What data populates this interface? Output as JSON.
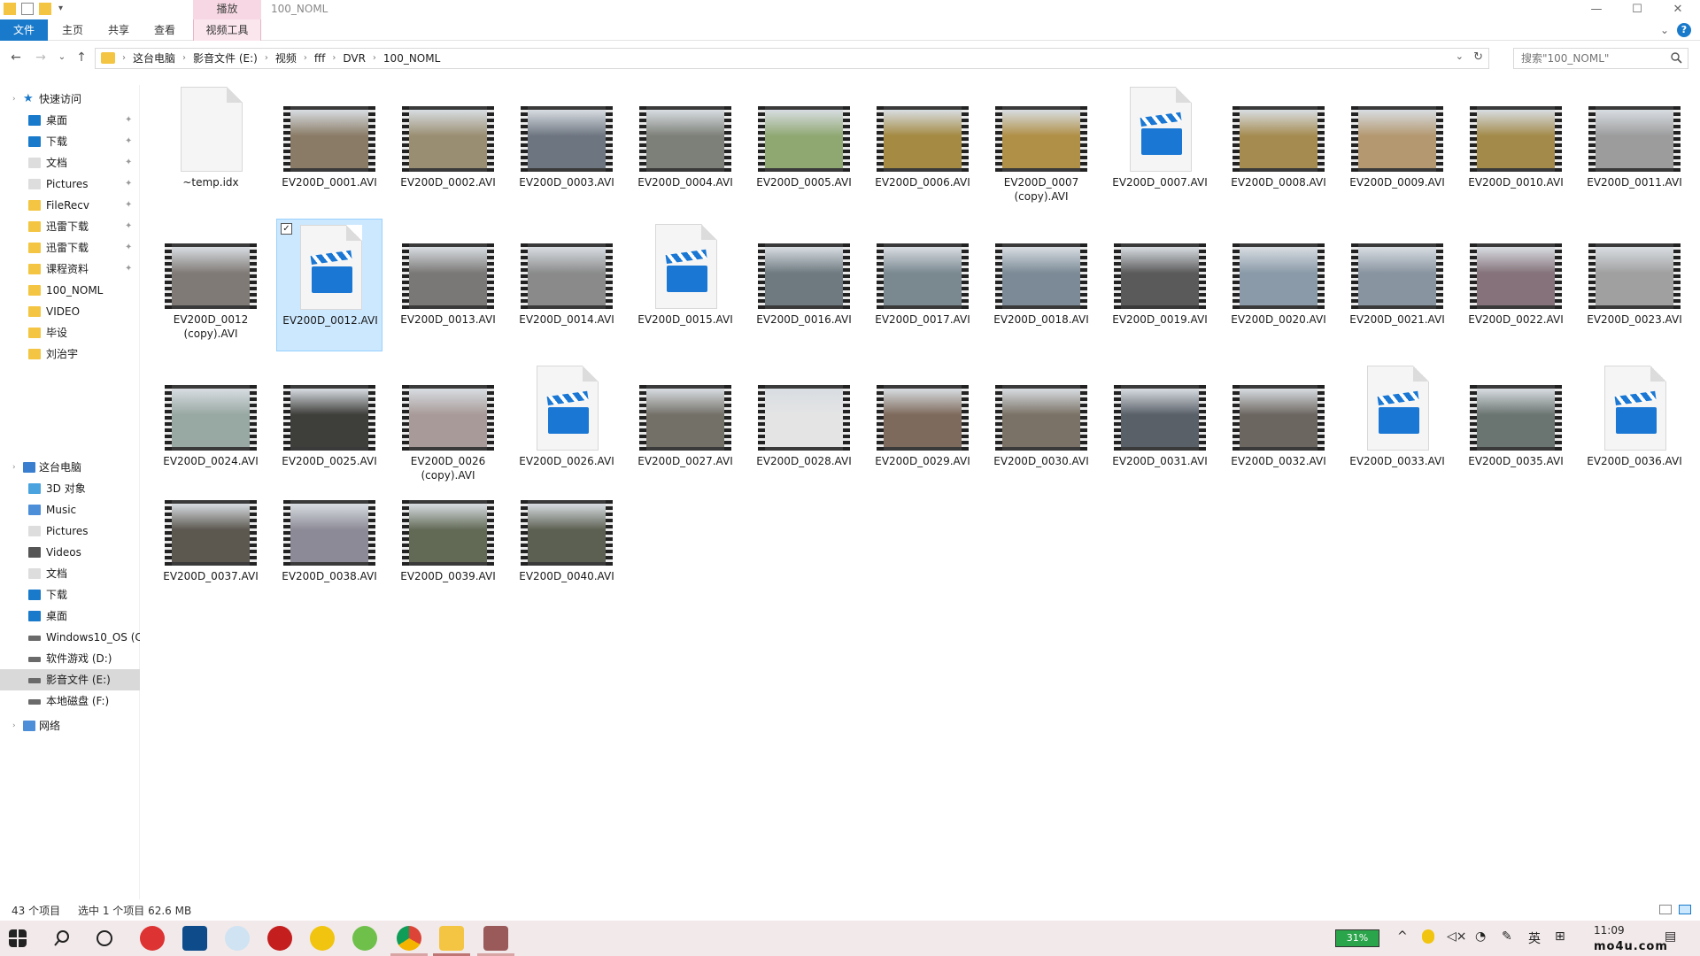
{
  "window": {
    "title": "100_NOML",
    "context_tab_group": "播放",
    "minimize": "—",
    "maximize": "☐",
    "close": "✕"
  },
  "ribbon": {
    "tabs": [
      "文件",
      "主页",
      "共享",
      "查看",
      "视频工具"
    ],
    "collapse": "⌄",
    "help": "?"
  },
  "nav": {
    "back": "←",
    "forward": "→",
    "recent": "⌄",
    "up": "↑"
  },
  "address": {
    "crumbs": [
      "这台电脑",
      "影音文件 (E:)",
      "视频",
      "fff",
      "DVR",
      "100_NOML"
    ],
    "separator": "›",
    "dropdown": "⌄",
    "refresh": "↻"
  },
  "search": {
    "placeholder": "搜索\"100_NOML\""
  },
  "sidebar": {
    "quick_access": "快速访问",
    "quick_items": [
      "桌面",
      "下载",
      "文档",
      "Pictures",
      "FileRecv",
      "迅雷下载",
      "迅雷下载",
      "课程资料",
      "100_NOML",
      "VIDEO",
      "毕设",
      "刘治宇"
    ],
    "this_pc": "这台电脑",
    "pc_items": [
      "3D 对象",
      "Music",
      "Pictures",
      "Videos",
      "文档",
      "下载",
      "桌面",
      "Windows10_OS (C",
      "软件游戏 (D:)",
      "影音文件 (E:)",
      "本地磁盘 (F:)"
    ],
    "network": "网络",
    "pin": "✦"
  },
  "files": [
    {
      "name": "~temp.idx",
      "kind": "doc",
      "color": "#ffffff"
    },
    {
      "name": "EV200D_0001.AVI",
      "kind": "video",
      "color": "#8a7b66"
    },
    {
      "name": "EV200D_0002.AVI",
      "kind": "video",
      "color": "#9a8e72"
    },
    {
      "name": "EV200D_0003.AVI",
      "kind": "video",
      "color": "#6d7580"
    },
    {
      "name": "EV200D_0004.AVI",
      "kind": "video",
      "color": "#7d8078"
    },
    {
      "name": "EV200D_0005.AVI",
      "kind": "video",
      "color": "#8fa872"
    },
    {
      "name": "EV200D_0006.AVI",
      "kind": "video",
      "color": "#a48a42"
    },
    {
      "name": "EV200D_0007 (copy).AVI",
      "kind": "video",
      "color": "#b08f46"
    },
    {
      "name": "EV200D_0007.AVI",
      "kind": "clap",
      "color": "#1a78d4"
    },
    {
      "name": "EV200D_0008.AVI",
      "kind": "video",
      "color": "#a58b50"
    },
    {
      "name": "EV200D_0009.AVI",
      "kind": "video",
      "color": "#b49870"
    },
    {
      "name": "EV200D_0010.AVI",
      "kind": "video",
      "color": "#a38a4a"
    },
    {
      "name": "EV200D_0011.AVI",
      "kind": "video",
      "color": "#9c9c9c"
    },
    {
      "name": "EV200D_0012 (copy).AVI",
      "kind": "video",
      "color": "#807a76"
    },
    {
      "name": "EV200D_0012.AVI",
      "kind": "clap",
      "color": "#1a78d4",
      "selected": true
    },
    {
      "name": "EV200D_0013.AVI",
      "kind": "video",
      "color": "#7a7876"
    },
    {
      "name": "EV200D_0014.AVI",
      "kind": "video",
      "color": "#8a8a8a"
    },
    {
      "name": "EV200D_0015.AVI",
      "kind": "clap",
      "color": "#1a78d4"
    },
    {
      "name": "EV200D_0016.AVI",
      "kind": "video",
      "color": "#6e7a80"
    },
    {
      "name": "EV200D_0017.AVI",
      "kind": "video",
      "color": "#7a8890"
    },
    {
      "name": "EV200D_0018.AVI",
      "kind": "video",
      "color": "#7b8a96"
    },
    {
      "name": "EV200D_0019.AVI",
      "kind": "video",
      "color": "#5a5a5a"
    },
    {
      "name": "EV200D_0020.AVI",
      "kind": "video",
      "color": "#8a9aa8"
    },
    {
      "name": "EV200D_0021.AVI",
      "kind": "video",
      "color": "#8894a0"
    },
    {
      "name": "EV200D_0022.AVI",
      "kind": "video",
      "color": "#85727a"
    },
    {
      "name": "EV200D_0023.AVI",
      "kind": "video",
      "color": "#a0a0a0"
    },
    {
      "name": "EV200D_0024.AVI",
      "kind": "video",
      "color": "#98a8a2"
    },
    {
      "name": "EV200D_0025.AVI",
      "kind": "video",
      "color": "#3e3e3a"
    },
    {
      "name": "EV200D_0026 (copy).AVI",
      "kind": "video",
      "color": "#a89a98"
    },
    {
      "name": "EV200D_0026.AVI",
      "kind": "clap",
      "color": "#1a78d4"
    },
    {
      "name": "EV200D_0027.AVI",
      "kind": "video",
      "color": "#737068"
    },
    {
      "name": "EV200D_0028.AVI",
      "kind": "video",
      "color": "#e4e4e4"
    },
    {
      "name": "EV200D_0029.AVI",
      "kind": "video",
      "color": "#7e6a5c"
    },
    {
      "name": "EV200D_0030.AVI",
      "kind": "video",
      "color": "#7a7266"
    },
    {
      "name": "EV200D_0031.AVI",
      "kind": "video",
      "color": "#5a6068"
    },
    {
      "name": "EV200D_0032.AVI",
      "kind": "video",
      "color": "#6c6660"
    },
    {
      "name": "EV200D_0033.AVI",
      "kind": "clap",
      "color": "#1a78d4"
    },
    {
      "name": "EV200D_0035.AVI",
      "kind": "video",
      "color": "#6a7470"
    },
    {
      "name": "EV200D_0036.AVI",
      "kind": "clap",
      "color": "#1a78d4"
    },
    {
      "name": "EV200D_0037.AVI",
      "kind": "video",
      "color": "#5c5850"
    },
    {
      "name": "EV200D_0038.AVI",
      "kind": "video",
      "color": "#8c8a96"
    },
    {
      "name": "EV200D_0039.AVI",
      "kind": "video",
      "color": "#626a56"
    },
    {
      "name": "EV200D_0040.AVI",
      "kind": "video",
      "color": "#5c6052"
    }
  ],
  "status": {
    "count": "43 个项目",
    "selection": "选中 1 个项目  62.6 MB"
  },
  "taskbar": {
    "battery": "31%",
    "ime": "英",
    "time": "11:09",
    "watermark": "mo4u.com"
  },
  "colors": {
    "accent": "#1979ca",
    "selected_tile": "#cce8ff",
    "context_tab": "#f7d7e3",
    "taskbar": "#f2e9ea"
  }
}
